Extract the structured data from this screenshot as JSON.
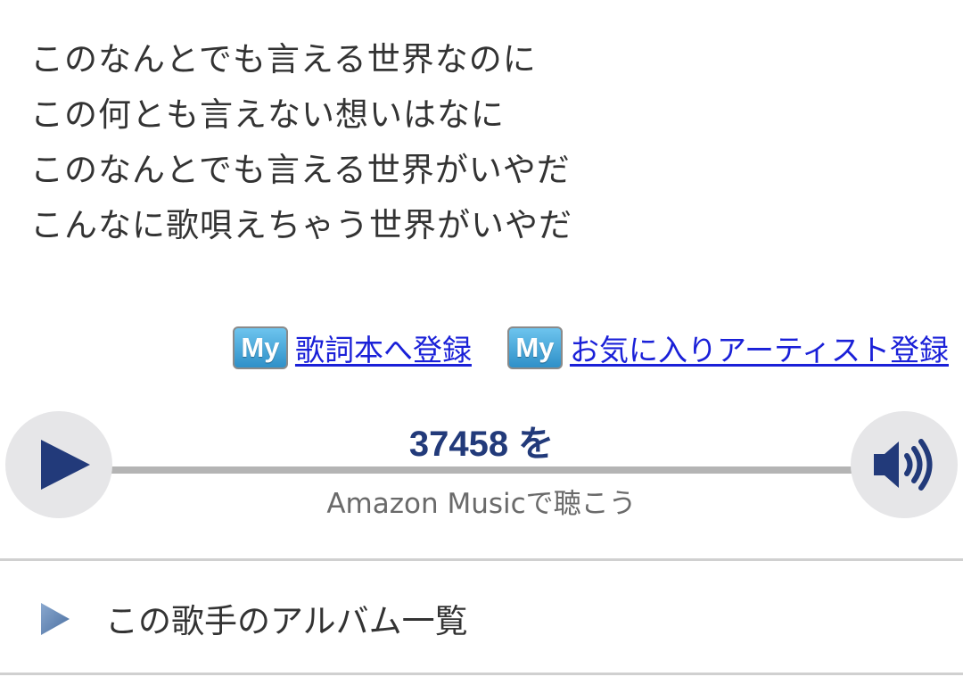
{
  "lyrics": {
    "lines": [
      "このなんとでも言える世界なのに",
      "この何とも言えない想いはなに",
      "このなんとでも言える世界がいやだ",
      "こんなに歌唄えちゃう世界がいやだ"
    ]
  },
  "actions": {
    "badge_text": "My",
    "lyric_book_link": "歌詞本へ登録",
    "favorite_artist_link": "お気に入りアーティスト登録",
    "link_color": "#1a20d8"
  },
  "player": {
    "title": "37458 を",
    "subtitle": "Amazon Musicで聴こう",
    "play_icon": "play-icon",
    "volume_icon": "volume-icon",
    "accent_color": "#223a7a"
  },
  "album_list": {
    "label": "この歌手のアルバム一覧",
    "arrow_icon": "triangle-right-icon"
  }
}
